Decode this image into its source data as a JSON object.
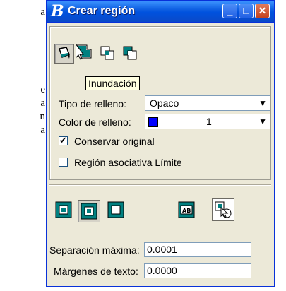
{
  "background_text": {
    "lines": [
      "a",
      "",
      "",
      "",
      "",
      "e",
      "a",
      "n",
      "a"
    ]
  },
  "window": {
    "title": "Crear región",
    "logo": "B",
    "minimize_glyph": "_",
    "maximize_glyph": "□",
    "close_glyph": "✕"
  },
  "toolbar": {
    "tooltip": "Inundación",
    "icons": [
      "flood-icon",
      "union-icon",
      "intersection-icon",
      "difference-icon"
    ]
  },
  "form": {
    "fill_type_label": "Tipo de relleno:",
    "fill_type_value": "Opaco",
    "fill_color_label": "Color de relleno:",
    "fill_color_value": "1",
    "fill_color_hex": "#0000ff",
    "keep_original_label": "Conservar original",
    "keep_original_checked": true,
    "associative_label": "Región asociativa Límite",
    "associative_checked": false
  },
  "bottom": {
    "max_gap_label": "Separación máxima:",
    "max_gap_value": "0.0001",
    "text_margin_label": "Márgenes de texto:",
    "text_margin_value": "0.0000"
  },
  "colors": {
    "title_blue": "#0a5be0",
    "icon_teal": "#008080",
    "dialog_bg": "#ece9d8"
  }
}
